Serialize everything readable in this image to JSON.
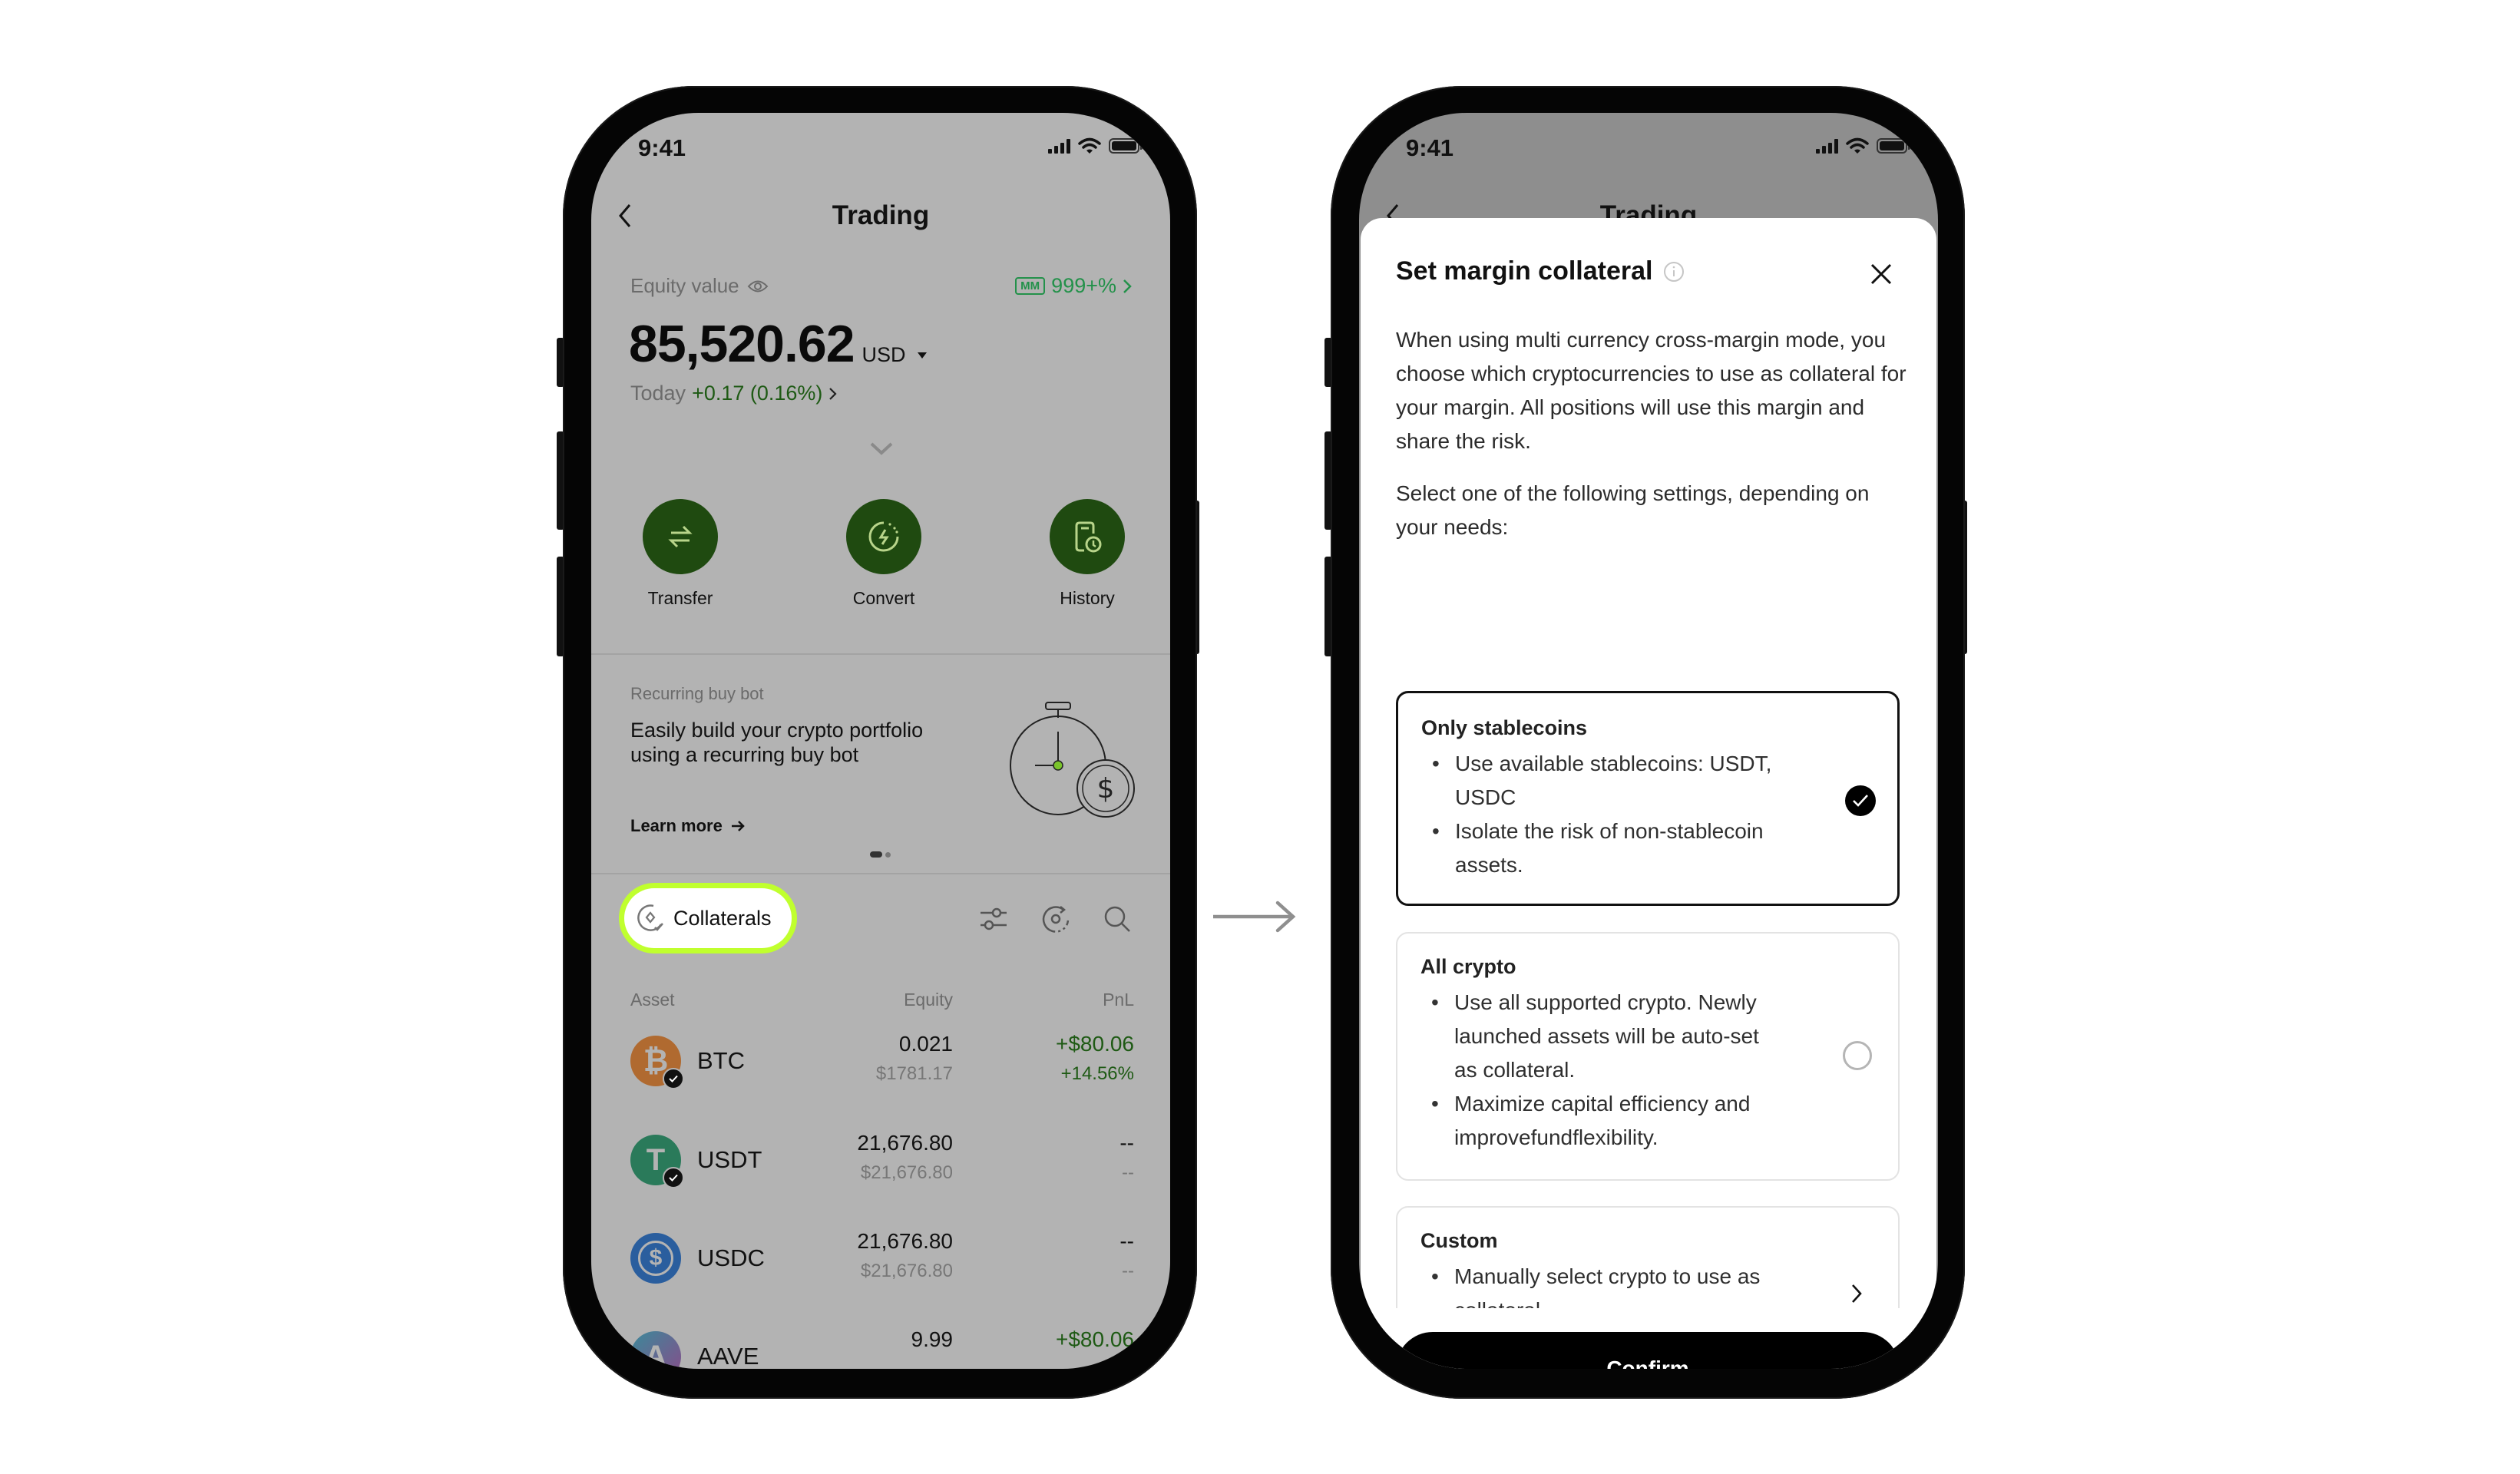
{
  "status_bar": {
    "time": "9:41"
  },
  "left_screen": {
    "nav": {
      "title": "Trading",
      "back_icon": "chevron-left-icon"
    },
    "equity": {
      "label": "Equity value",
      "eye_icon": "eye-icon",
      "mm_badge": "MM",
      "mm_ratio": "999+%",
      "value": "85,520.62",
      "currency": "USD",
      "today_label": "Today",
      "today_change": "+0.17 (0.16%)"
    },
    "actions": [
      {
        "label": "Transfer",
        "icon": "transfer-arrows-icon"
      },
      {
        "label": "Convert",
        "icon": "convert-bolt-icon"
      },
      {
        "label": "History",
        "icon": "history-clock-icon"
      }
    ],
    "promo": {
      "eyebrow": "Recurring buy bot",
      "headline_line1": "Easily build your crypto portfolio",
      "headline_line2": "using a recurring buy bot",
      "cta": "Learn more",
      "page_index": 1,
      "page_count": 2
    },
    "toolbar": {
      "collaterals_label": "Collaterals",
      "highlight_color": "#c0ff2e",
      "icons": [
        "filter-sliders-icon",
        "refresh-target-icon",
        "search-icon"
      ]
    },
    "table": {
      "headers": {
        "asset": "Asset",
        "equity": "Equity",
        "pnl": "PnL"
      },
      "rows": [
        {
          "asset": "BTC",
          "equity": "0.021",
          "equity_usd": "$1781.17",
          "pnl": "+$80.06",
          "pnl_pct": "+14.56%",
          "color": "#b06a30",
          "collateral": true
        },
        {
          "asset": "USDT",
          "equity": "21,676.80",
          "equity_usd": "$21,676.80",
          "pnl": "--",
          "pnl_pct": "--",
          "color": "#2a7a5a",
          "collateral": true
        },
        {
          "asset": "USDC",
          "equity": "21,676.80",
          "equity_usd": "$21,676.80",
          "pnl": "--",
          "pnl_pct": "--",
          "color": "#2a5e9e",
          "collateral": false
        },
        {
          "asset": "AAVE",
          "equity": "9.99",
          "equity_usd": "",
          "pnl": "+$80.06",
          "pnl_pct": "",
          "color": "#7a5a8a",
          "collateral": false
        }
      ]
    }
  },
  "right_screen": {
    "background_nav_title": "Trading",
    "sheet": {
      "title": "Set margin collateral",
      "intro": "When using multi currency cross-margin mode, you choose which cryptocurrencies to use as collateral for your margin. All positions will use this margin and share the risk.",
      "prompt": "Select one of the following settings, depending on your needs:",
      "options": [
        {
          "title": "Only stablecoins",
          "bullets": [
            "Use available stablecoins: USDT, USDC",
            "Isolate the risk of non-stablecoin assets."
          ],
          "selected": true,
          "control": "radio"
        },
        {
          "title": "All crypto",
          "bullets": [
            "Use all supported crypto. Newly launched assets will be auto-set as collateral.",
            "Maximize capital efficiency and improvefundflexibility."
          ],
          "selected": false,
          "control": "radio"
        },
        {
          "title": "Custom",
          "bullets": [
            "Manually select crypto to use as collateral"
          ],
          "selected": false,
          "control": "chevron"
        }
      ],
      "confirm_label": "Confirm"
    }
  }
}
